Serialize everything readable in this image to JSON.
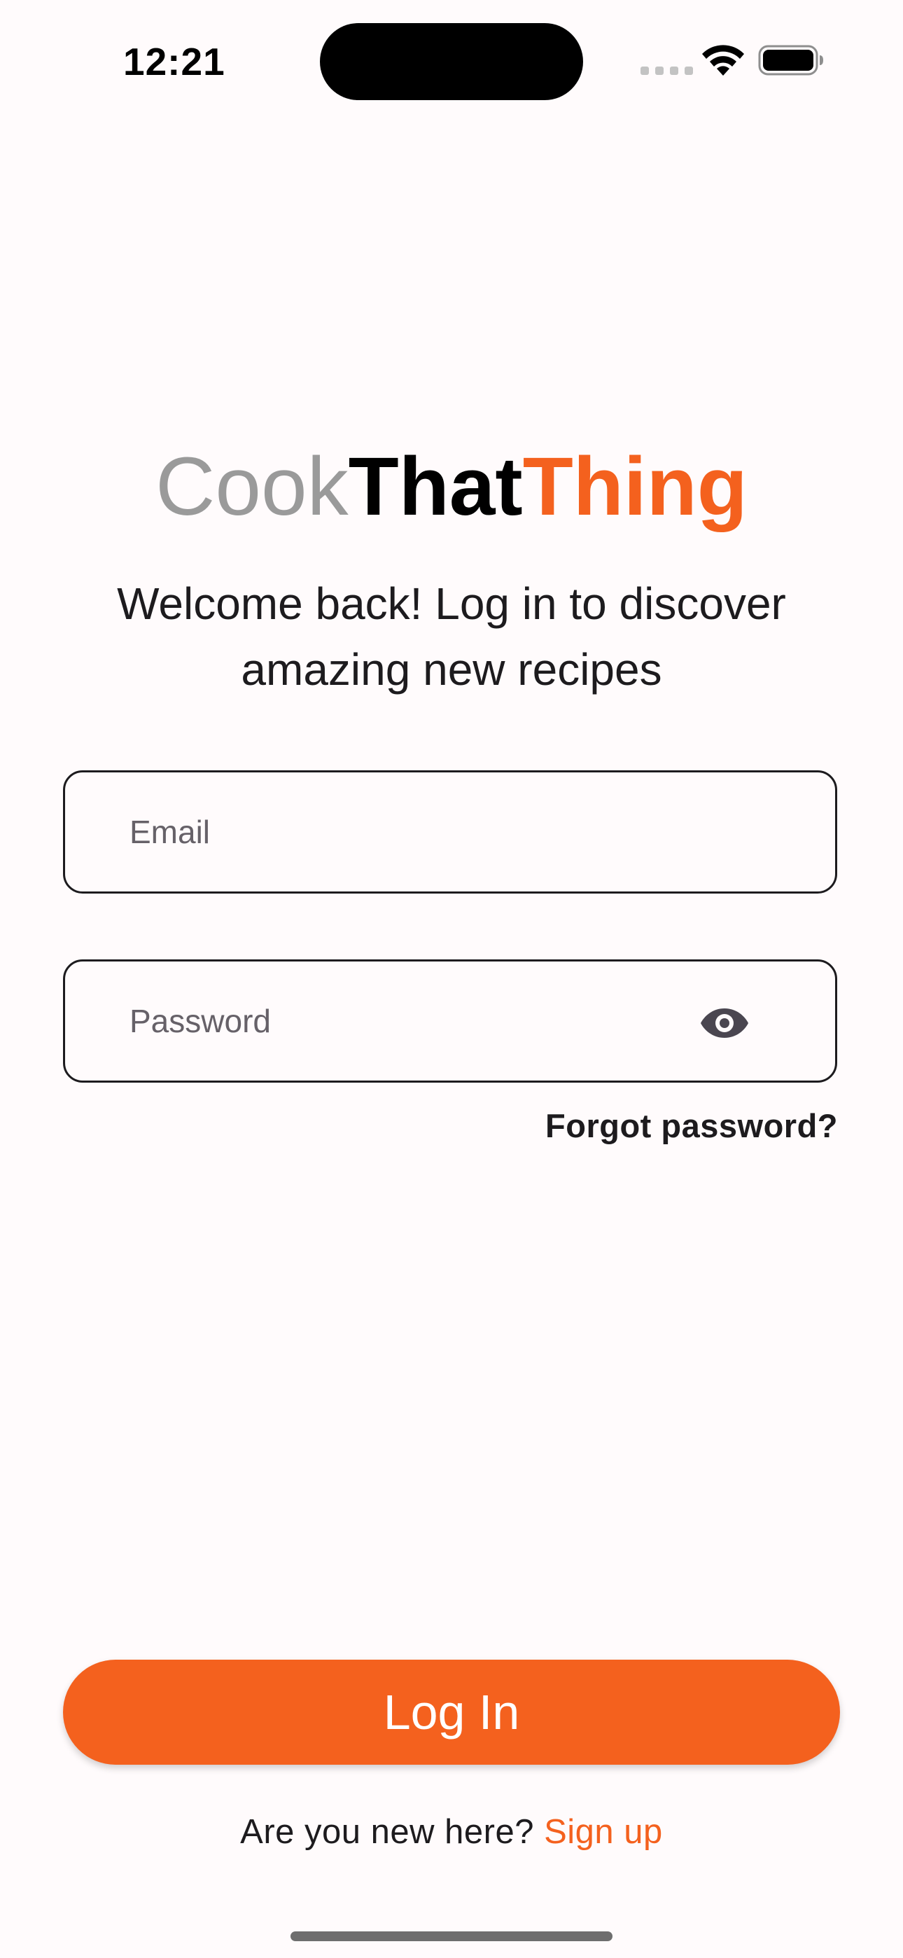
{
  "status_bar": {
    "time": "12:21"
  },
  "brand": {
    "part1": "Cook",
    "part2": "That",
    "part3": "Thing",
    "colors": {
      "part1": "#9a9a9a",
      "part2": "#000000",
      "part3": "#f4611e"
    }
  },
  "subtitle": {
    "line1": "Welcome back! Log in to discover",
    "line2": "amazing new recipes"
  },
  "email_field": {
    "value": "",
    "placeholder": "Email"
  },
  "password_field": {
    "value": "",
    "placeholder": "Password",
    "toggle_icon": "eye-icon"
  },
  "forgot_password": "Forgot password?",
  "login_button": "Log In",
  "signup": {
    "prompt": "Are you new here?",
    "link": "Sign up"
  },
  "accent_color": "#f4611e"
}
